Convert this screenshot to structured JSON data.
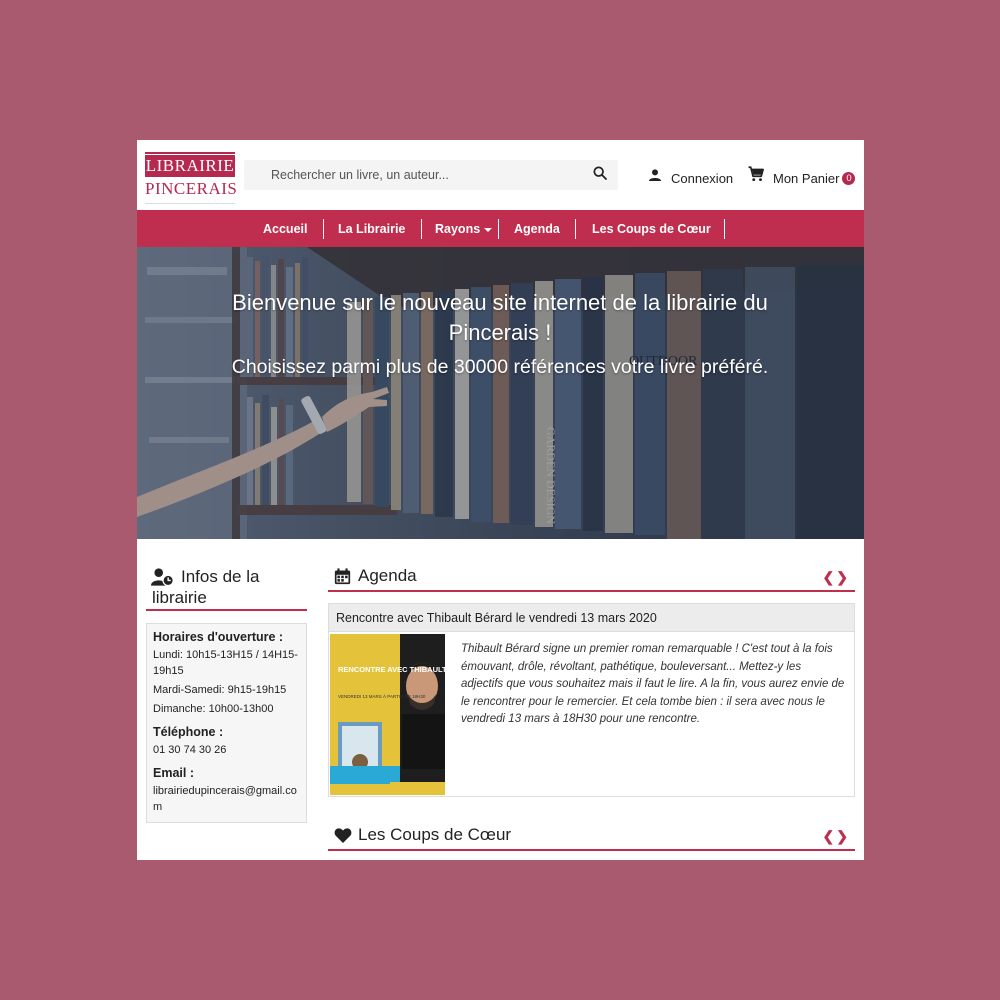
{
  "brand": {
    "logo_line1": "LIBRAIRIE",
    "logo_line2": "PINCERAIS",
    "accent_color": "#bf2e4e",
    "page_background": "#a95a6e"
  },
  "header": {
    "search_placeholder": "Rechercher un livre, un auteur...",
    "search_icon": "magnifier-icon",
    "login_label": "Connexion",
    "login_icon": "user-icon",
    "cart_label": "Mon Panier",
    "cart_icon": "shopping-cart-icon",
    "cart_count": "0"
  },
  "nav": {
    "items": [
      {
        "label": "Accueil"
      },
      {
        "label": "La Librairie"
      },
      {
        "label": "Rayons",
        "has_dropdown": true
      },
      {
        "label": "Agenda"
      },
      {
        "label": "Les Coups de Cœur"
      }
    ]
  },
  "hero": {
    "title": "Bienvenue sur le nouveau site internet de la librairie du Pincerais !",
    "subtitle": "Choisissez parmi plus de 30000 références votre livre préféré.",
    "book_spine_texts": [
      "OUTDOOR",
      "GARDEN DESIGN"
    ]
  },
  "sidebar": {
    "title": "Infos de la librairie",
    "icon": "user-clock-icon",
    "hours_label": "Horaires d'ouverture :",
    "hours": [
      "Lundi: 10h15-13H15 / 14H15-19h15",
      "Mardi-Samedi: 9h15-19h15",
      "Dimanche: 10h00-13h00"
    ],
    "phone_label": "Téléphone :",
    "phone": "01 30 74 30 26",
    "email_label": "Email :",
    "email": "librairiedupincerais@gmail.com"
  },
  "agenda": {
    "title": "Agenda",
    "icon": "calendar-icon",
    "event_title": "Rencontre avec Thibault Bérard le vendredi 13 mars 2020",
    "poster_heading": "RENCONTRE AVEC THIBAULT BÉRARD",
    "poster_date": "VENDREDI 13 MARS À PARTIR DE 18H30",
    "description_lines": [
      "Thibault Bérard signe un premier roman remarquable ! C'est tout à la fois",
      "émouvant, drôle, révoltant, pathétique, bouleversant... Mettez-y les",
      "adjectifs que vous souhaitez mais il faut le lire. A la fin, vous aurez envie de",
      "le rencontrer pour le remercier. Et cela tombe bien : il sera avec nous le",
      "vendredi 13 mars à 18H30 pour une rencontre."
    ]
  },
  "coups": {
    "title": "Les Coups de Cœur",
    "icon": "heart-icon"
  }
}
